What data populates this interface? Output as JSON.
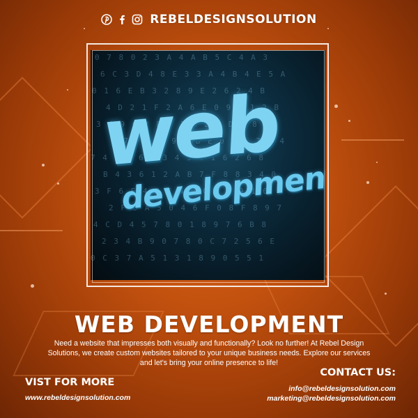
{
  "header": {
    "brand": "REBELDESIGNSOLUTION",
    "social_icons": [
      "pinterest-icon",
      "facebook-icon",
      "instagram-icon"
    ]
  },
  "hero_image": {
    "word_large": "web",
    "word_small": "development",
    "code_lines": [
      "0 7 8 0  2 3 A 4 A B  5 C 4 A 3",
      "6 C 3 D  4 8 E 3 3 A 4 B 4 E 5 A",
      "0 1 6 E  B 3 2 8 9 E 2 6 2 4 B",
      "4 D 2 1  F 2 A 6 E 0 9 3 1 2 B",
      "3 4 9 C  2 E 7 1 A 2 4 D 9 8 4",
      "2 7 F 1  3 9 4 B E 0 9 1 7 1 4",
      "7 4 E 0  6 C 3 4 5 C 1 6 2 6 8",
      "B 4 3 6  1 2 A B 7 F 8 8 3 4 0",
      "3 F 6 E  4 B C 4 B 0 3 E 9 1 0",
      "2 F 0 A  5 0 4 6 F 0 8 F 8 9 7",
      "4 C D 4  5 7 8 0 1 8 9 7 6 B 8",
      "2 3 4 B  9 0 7 8 0 C 7 2 5 6 E",
      "0 C 3 7  A 5 1 3 1 8 9 0 5 5 1"
    ]
  },
  "headline": "WEB DEVELOPMENT",
  "body_text": "Need a website that impresses both visually and functionally? Look no further! At Rebel Design Solutions, we create custom websites tailored to your unique business needs. Explore our services and let's bring your online presence to life!",
  "footer": {
    "visit_label": "VIST FOR MORE",
    "visit_url": "www.rebeldesignsolution.com",
    "contact_label": "CONTACT US:",
    "emails": [
      "info@rebeldesignsolution.com",
      "marketing@rebeldesignsolution.com"
    ]
  },
  "colors": {
    "background": "#c4520f",
    "text": "#ffffff",
    "frame": "#f4e9e2",
    "hero_text": "#7fd3f2"
  }
}
